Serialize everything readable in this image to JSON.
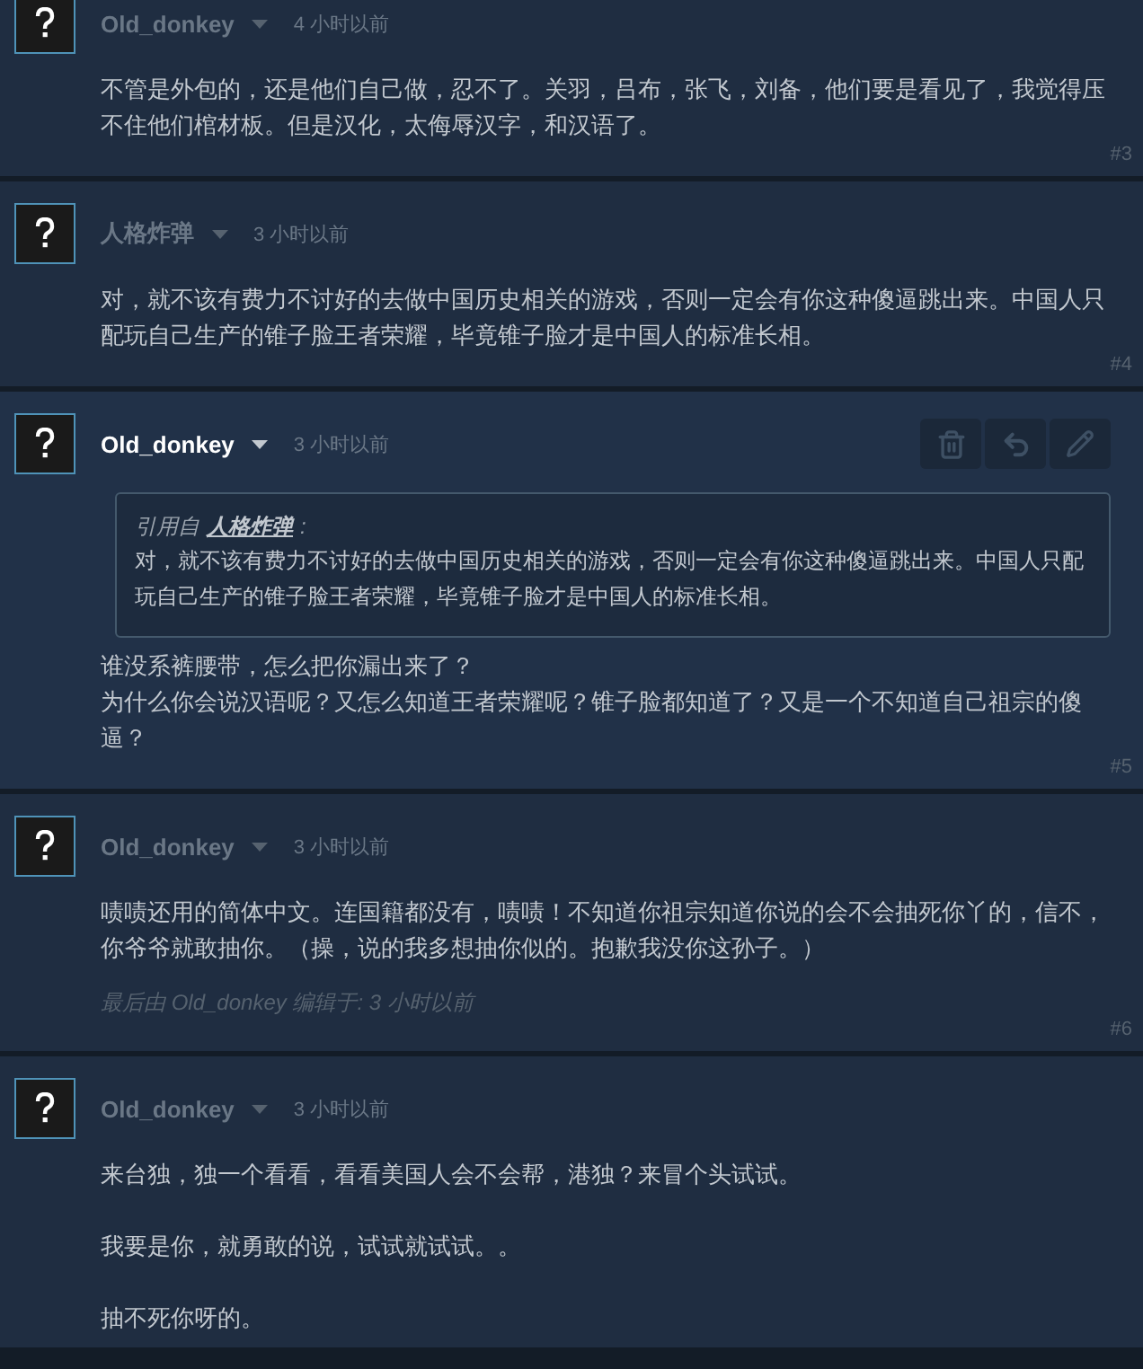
{
  "posts": [
    {
      "author": "Old_donkey",
      "time": "4 小时以前",
      "highlighted": false,
      "show_actions": false,
      "paragraphs": [
        [
          "不管是外包的，还是他们自己做，忍不了。关羽，吕布，张飞，刘备，他们要是看见了，我觉得压不住他们棺材板。但是汉化，太侮辱汉字，和汉语了。"
        ]
      ],
      "number": "#3"
    },
    {
      "author": "人格炸弹",
      "time": "3 小时以前",
      "highlighted": false,
      "show_actions": false,
      "paragraphs": [
        [
          "对，就不该有费力不讨好的去做中国历史相关的游戏，否则一定会有你这种傻逼跳出来。中国人只配玩自己生产的锥子脸王者荣耀，毕竟锥子脸才是中国人的标准长相。"
        ]
      ],
      "number": "#4"
    },
    {
      "author": "Old_donkey",
      "time": "3 小时以前",
      "highlighted": true,
      "show_actions": true,
      "quote": {
        "prefix": "引用自",
        "author": "人格炸弹",
        "colon": ":",
        "text": "对，就不该有费力不讨好的去做中国历史相关的游戏，否则一定会有你这种傻逼跳出来。中国人只配玩自己生产的锥子脸王者荣耀，毕竟锥子脸才是中国人的标准长相。"
      },
      "paragraphs": [
        [
          "谁没系裤腰带，怎么把你漏出来了？",
          "为什么你会说汉语呢？又怎么知道王者荣耀呢？锥子脸都知道了？又是一个不知道自己祖宗的傻逼？"
        ]
      ],
      "number": "#5"
    },
    {
      "author": "Old_donkey",
      "time": "3 小时以前",
      "highlighted": false,
      "show_actions": false,
      "paragraphs": [
        [
          "啧啧还用的简体中文。连国籍都没有，啧啧！不知道你祖宗知道你说的会不会抽死你丫的，信不，你爷爷就敢抽你。（操，说的我多想抽你似的。抱歉我没你这孙子。）"
        ]
      ],
      "edited": "最后由 Old_donkey 编辑于: 3 小时以前",
      "number": "#6"
    },
    {
      "author": "Old_donkey",
      "time": "3 小时以前",
      "highlighted": false,
      "show_actions": false,
      "paragraphs": [
        [
          "来台独，独一个看看，看看美国人会不会帮，港独？来冒个头试试。"
        ],
        [
          "我要是你，就勇敢的说，试试就试试。。"
        ],
        [
          "抽不死你呀的。"
        ]
      ]
    }
  ]
}
